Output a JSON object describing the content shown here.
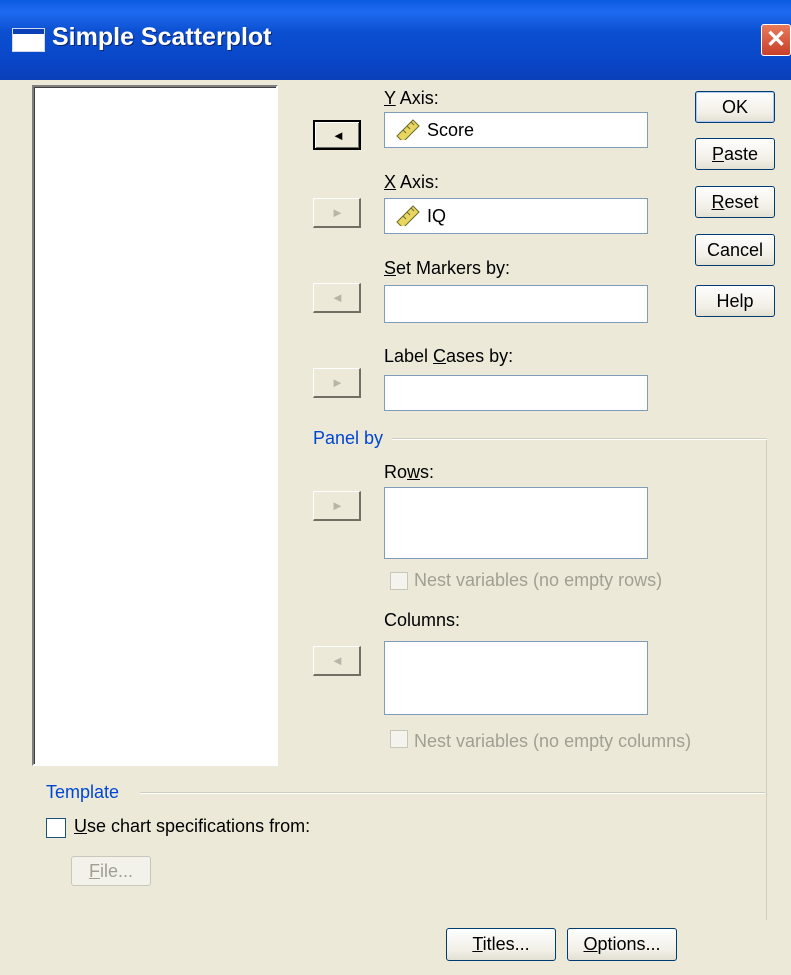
{
  "dialog": {
    "title": "Simple Scatterplot",
    "close_glyph": "✕"
  },
  "fields": {
    "y_axis": {
      "label_key": "Y",
      "label_rest": " Axis:",
      "value": "Score"
    },
    "x_axis": {
      "label_key": "X",
      "label_rest": " Axis:",
      "value": "IQ"
    },
    "set_markers": {
      "label_key": "S",
      "label_rest": "et Markers by:",
      "value": ""
    },
    "label_cases": {
      "label_pre": "Label ",
      "label_key": "C",
      "label_rest": "ases by:",
      "value": ""
    }
  },
  "panel_by": {
    "section_label": "Panel by",
    "rows": {
      "label_pre": "Ro",
      "label_key": "w",
      "label_rest": "s:"
    },
    "nest_rows_label": "Nest variables (no empty rows)",
    "columns": {
      "label": "Columns:"
    },
    "nest_columns_label": "Nest variables (no empty columns)"
  },
  "template": {
    "section_label": "Template",
    "use_spec_key": "U",
    "use_spec_rest": "se chart specifications from:",
    "file_key": "F",
    "file_rest": "ile..."
  },
  "buttons": {
    "ok": "OK",
    "paste_key": "P",
    "paste_rest": "aste",
    "reset_key": "R",
    "reset_rest": "eset",
    "cancel": "Cancel",
    "help": "Help",
    "titles_key": "T",
    "titles_rest": "itles...",
    "options_key": "O",
    "options_rest": "ptions..."
  },
  "icons": {
    "variable_icon": "scale-ruler-icon",
    "arrow_left": "◄",
    "arrow_right": "►"
  },
  "colors": {
    "title_bar": "#0a4fd0",
    "section_label": "#0046d5",
    "close_button": "#d9553a"
  }
}
